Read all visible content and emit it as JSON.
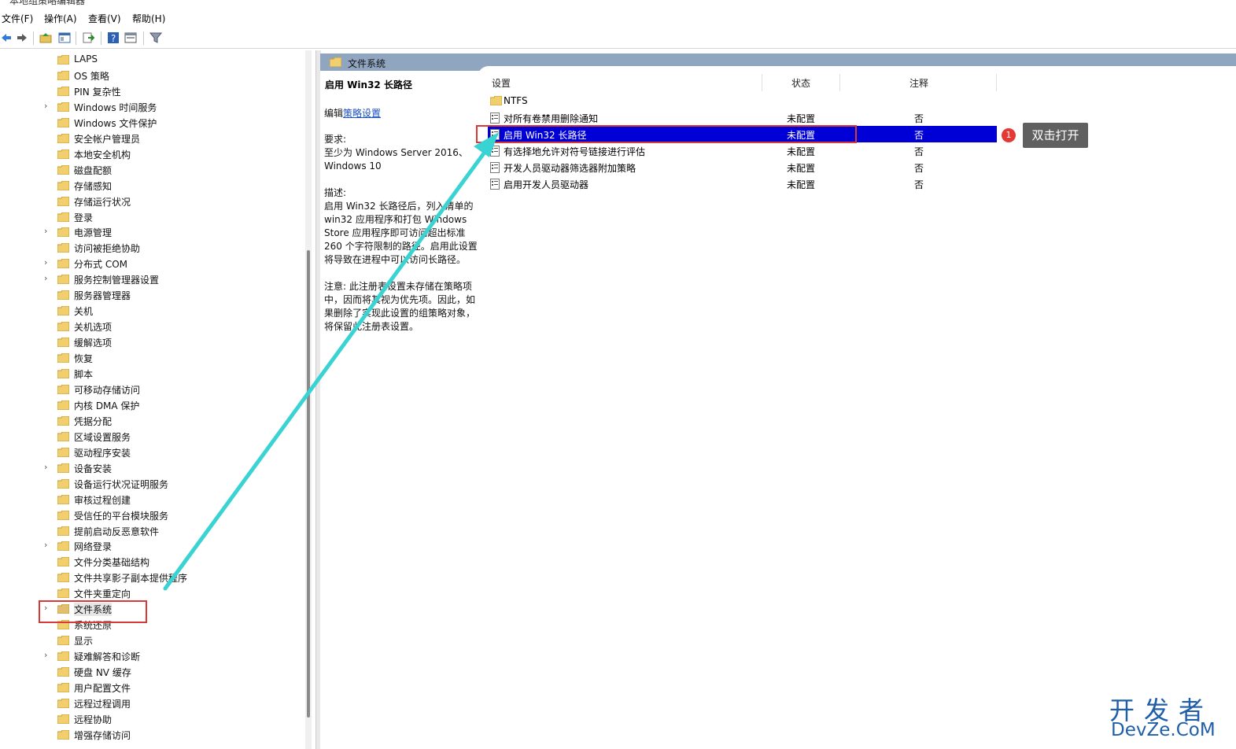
{
  "window": {
    "title": "本地组策略编辑器"
  },
  "menu": [
    "文件(F)",
    "操作(A)",
    "查看(V)",
    "帮助(H)"
  ],
  "toolbar": [
    "back-icon",
    "forward-icon",
    "up-folder-icon",
    "show-hide-tree-icon",
    "export-list-icon",
    "help-icon",
    "properties-icon",
    "filter-icon"
  ],
  "tree": [
    {
      "label": "LAPS",
      "expandable": false
    },
    {
      "label": "OS 策略",
      "expandable": false
    },
    {
      "label": "PIN 复杂性",
      "expandable": false
    },
    {
      "label": "Windows 时间服务",
      "expandable": true
    },
    {
      "label": "Windows 文件保护",
      "expandable": false
    },
    {
      "label": "安全帐户管理员",
      "expandable": false
    },
    {
      "label": "本地安全机构",
      "expandable": false
    },
    {
      "label": "磁盘配额",
      "expandable": false
    },
    {
      "label": "存储感知",
      "expandable": false
    },
    {
      "label": "存储运行状况",
      "expandable": false
    },
    {
      "label": "登录",
      "expandable": false
    },
    {
      "label": "电源管理",
      "expandable": true
    },
    {
      "label": "访问被拒绝协助",
      "expandable": false
    },
    {
      "label": "分布式 COM",
      "expandable": true
    },
    {
      "label": "服务控制管理器设置",
      "expandable": true
    },
    {
      "label": "服务器管理器",
      "expandable": false
    },
    {
      "label": "关机",
      "expandable": false
    },
    {
      "label": "关机选项",
      "expandable": false
    },
    {
      "label": "缓解选项",
      "expandable": false
    },
    {
      "label": "恢复",
      "expandable": false
    },
    {
      "label": "脚本",
      "expandable": false
    },
    {
      "label": "可移动存储访问",
      "expandable": false
    },
    {
      "label": "内核 DMA 保护",
      "expandable": false
    },
    {
      "label": "凭据分配",
      "expandable": false
    },
    {
      "label": "区域设置服务",
      "expandable": false
    },
    {
      "label": "驱动程序安装",
      "expandable": false
    },
    {
      "label": "设备安装",
      "expandable": true
    },
    {
      "label": "设备运行状况证明服务",
      "expandable": false
    },
    {
      "label": "审核过程创建",
      "expandable": false
    },
    {
      "label": "受信任的平台模块服务",
      "expandable": false
    },
    {
      "label": "提前启动反恶意软件",
      "expandable": false
    },
    {
      "label": "网络登录",
      "expandable": true
    },
    {
      "label": "文件分类基础结构",
      "expandable": false
    },
    {
      "label": "文件共享影子副本提供程序",
      "expandable": false
    },
    {
      "label": "文件夹重定向",
      "expandable": false
    },
    {
      "label": "文件系统",
      "expandable": true,
      "selected": true
    },
    {
      "label": "系统还原",
      "expandable": false
    },
    {
      "label": "显示",
      "expandable": false
    },
    {
      "label": "疑难解答和诊断",
      "expandable": true
    },
    {
      "label": "硬盘 NV 缓存",
      "expandable": false
    },
    {
      "label": "用户配置文件",
      "expandable": false
    },
    {
      "label": "远程过程调用",
      "expandable": false
    },
    {
      "label": "远程协助",
      "expandable": false
    },
    {
      "label": "增强存储访问",
      "expandable": false
    }
  ],
  "right": {
    "header": "文件系统",
    "desc": {
      "title": "启用 Win32 长路径",
      "edit_prefix": "编辑",
      "edit_link": "策略设置",
      "req_label": "要求:",
      "req_line1": "至少为 Windows Server 2016、",
      "req_line2": "Windows 10",
      "desc_label": "描述:",
      "desc_lines": [
        "启用 Win32 长路径后，列入清单的",
        "win32 应用程序和打包 Windows",
        "Store 应用程序即可访问超出标准",
        "260 个字符限制的路径。启用此设置",
        "将导致在进程中可以访问长路径。"
      ],
      "note_lines": [
        "注意: 此注册表设置未存储在策略项",
        "中，因而将其视为优先项。因此，如",
        "果删除了实现此设置的组策略对象，",
        "将保留此注册表设置。"
      ]
    },
    "columns": [
      "设置",
      "状态",
      "注释"
    ],
    "rows": [
      {
        "name": "NTFS",
        "state": "",
        "note": "",
        "folder": true
      },
      {
        "name": "对所有卷禁用删除通知",
        "state": "未配置",
        "note": "否"
      },
      {
        "name": "启用 Win32 长路径",
        "state": "未配置",
        "note": "否",
        "selected": true
      },
      {
        "name": "有选择地允许对符号链接进行评估",
        "state": "未配置",
        "note": "否"
      },
      {
        "name": "开发人员驱动器筛选器附加策略",
        "state": "未配置",
        "note": "否"
      },
      {
        "name": "启用开发人员驱动器",
        "state": "未配置",
        "note": "否"
      }
    ]
  },
  "annotation": {
    "number": "1",
    "text": "双击打开"
  },
  "watermark": {
    "line1": "开发者",
    "line2": "DevZe.CoM"
  }
}
